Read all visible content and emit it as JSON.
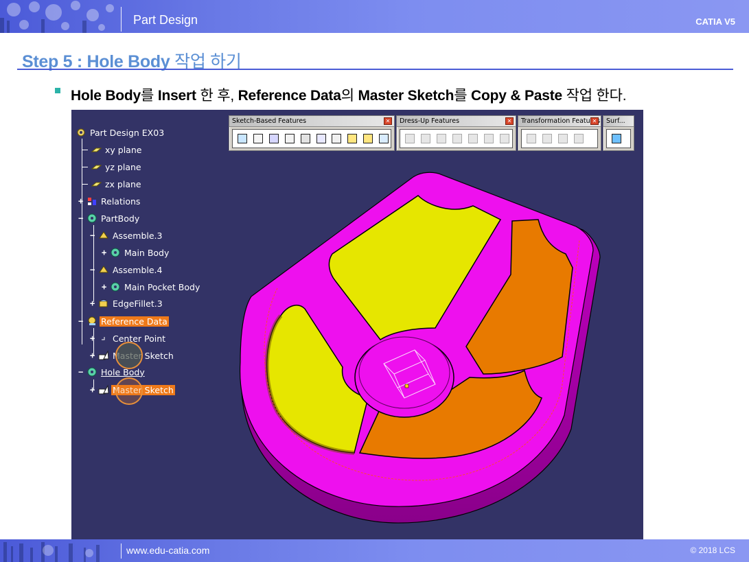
{
  "header": {
    "title": "Part Design",
    "product": "CATIA V5"
  },
  "footer": {
    "website": "www.edu-catia.com",
    "copyright": "© 2018 LCS"
  },
  "slide": {
    "step_title_en": "Step 5 : Hole Body",
    "step_title_kr": "작업 하기",
    "bullet": {
      "part1": "Hole Body",
      "part2": "를 ",
      "part3": "Insert",
      "part4": " 한 후, ",
      "part5": "Reference Data",
      "part6": "의 ",
      "part7": "Master Sketch",
      "part8": "를 ",
      "part9": "Copy & Paste",
      "part10": " 작업 한다."
    }
  },
  "toolbars": [
    {
      "title": "Sketch-Based Features",
      "icon": "sketch-based-features-icons"
    },
    {
      "title": "Dress-Up Features",
      "icon": "dress-up-features-icons"
    },
    {
      "title": "Transformation Features",
      "icon": "transformation-features-icons"
    },
    {
      "title": "Surf...",
      "icon": "surface-based-features-icons"
    }
  ],
  "tree": {
    "root": "Part Design EX03",
    "nodes": [
      {
        "label": "xy plane",
        "icon": "plane-icon"
      },
      {
        "label": "yz plane",
        "icon": "plane-icon"
      },
      {
        "label": "zx plane",
        "icon": "plane-icon"
      },
      {
        "label": "Relations",
        "icon": "relations-icon"
      },
      {
        "label": "PartBody",
        "icon": "body-gear-icon"
      },
      {
        "label": "Assemble.3",
        "icon": "assemble-icon"
      },
      {
        "label": "Main Body",
        "icon": "body-gear-icon"
      },
      {
        "label": "Assemble.4",
        "icon": "assemble-icon"
      },
      {
        "label": "Main Pocket Body",
        "icon": "body-gear-icon"
      },
      {
        "label": "EdgeFillet.3",
        "icon": "fillet-icon"
      },
      {
        "label": "Reference Data",
        "icon": "geometrical-set-icon"
      },
      {
        "label": "Center Point",
        "icon": "point-icon"
      },
      {
        "label": "Master Sketch",
        "icon": "sketch-icon"
      },
      {
        "label": "Hole Body",
        "icon": "body-gear-icon"
      },
      {
        "label": "Master Sketch",
        "icon": "sketch-icon"
      }
    ]
  },
  "colors": {
    "viewport_bg": "#333366",
    "part_magenta": "#ee10ee",
    "pocket_yellow": "#e6e600",
    "pocket_orange": "#e87a00",
    "tree_highlight": "#ef7a1a"
  }
}
